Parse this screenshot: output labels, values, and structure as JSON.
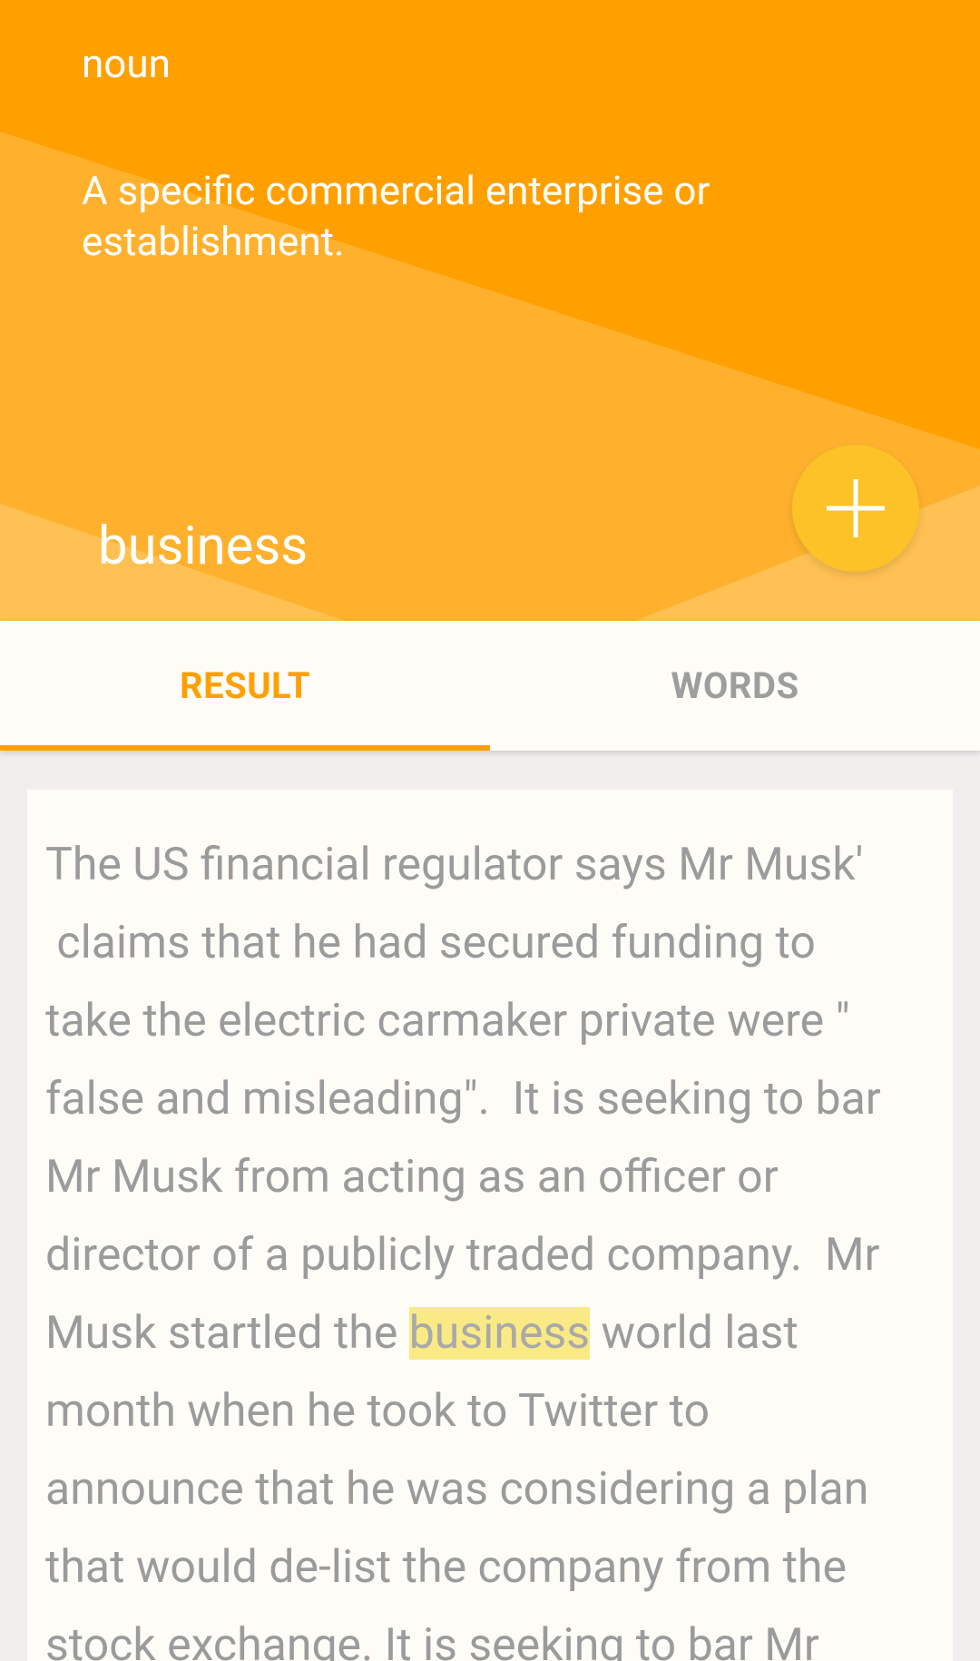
{
  "header": {
    "part_of_speech": "noun",
    "definition": "A specific commercial enterprise or establishment.",
    "word": "business",
    "add_button_icon": "plus-icon"
  },
  "tabs": [
    {
      "label": "RESULT",
      "selected": true
    },
    {
      "label": "WORDS",
      "selected": false
    }
  ],
  "passage": {
    "highlight": "business",
    "lines": [
      "The US financial regulator says Mr Musk'",
      " claims that he had secured funding to",
      "take the electric carmaker private were \"",
      "false and misleading\".  It is seeking to bar",
      "Mr Musk from acting as an officer or",
      "director of a publicly traded company.  Mr",
      {
        "before": "Musk startled the ",
        "highlight": "business",
        "after": " world last"
      },
      "month when he took to Twitter to",
      "announce that he was considering a plan",
      "that would de-list the company from the",
      "stock exchange. It is seeking to bar Mr"
    ]
  },
  "colors": {
    "accent": "#ffa000",
    "fab": "#fdc227",
    "highlight": "#f9ea85",
    "body_text": "#9b9b9b"
  }
}
